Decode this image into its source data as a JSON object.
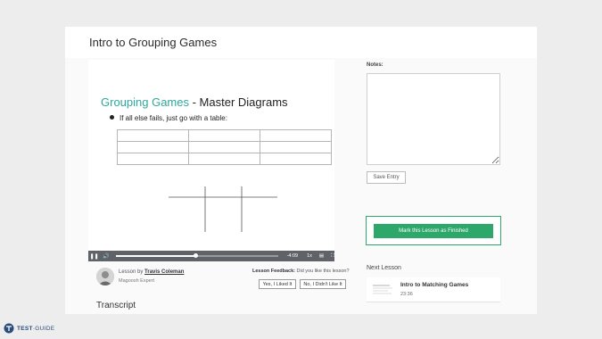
{
  "header": {
    "title": "Intro to Grouping Games"
  },
  "slide": {
    "title_accent": "Grouping Games",
    "title_rest": " - Master Diagrams",
    "bullet": "If all else fails, just go with a table:"
  },
  "player": {
    "play_state": "paused",
    "progress": 0.49,
    "time_remaining": "-4:09",
    "speed": "1x"
  },
  "lesson": {
    "by_prefix": "Lesson by ",
    "author": "Travis Coleman",
    "author_role": "Magoosh Expert",
    "feedback_label": "Lesson Feedback:",
    "feedback_question": " Did you like this lesson?",
    "yes_label": "Yes, I Liked It",
    "no_label": "No, I Didn't Like It"
  },
  "transcript_heading": "Transcript",
  "notes": {
    "label": "Notes:",
    "value": "",
    "save_label": "Save Entry"
  },
  "finish_label": "Mark this Lesson as Finished",
  "next": {
    "heading": "Next Lesson",
    "title": "Intro to Matching Games",
    "duration": "23:36"
  },
  "logo": {
    "brand": "TEST",
    "suffix": "GUIDE"
  },
  "colors": {
    "accent_teal": "#2ea89c",
    "finish_green": "#2ea86a",
    "player_bar": "#5f6368"
  }
}
